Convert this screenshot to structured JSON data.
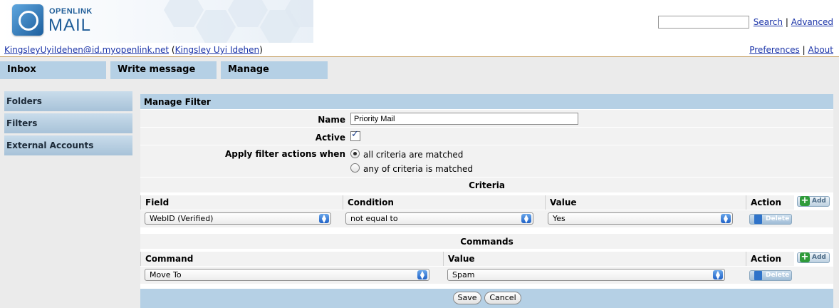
{
  "app": {
    "logo_top": "OPENLINK",
    "logo_bottom": "MAIL"
  },
  "top": {
    "search_value": "",
    "search_link": "Search",
    "separator": "|",
    "advanced_link": "Advanced"
  },
  "user": {
    "email": "KingsleyUyiIdehen@id.myopenlink.net",
    "open_paren": "(",
    "name": "Kingsley Uyi Idehen",
    "close_paren": ")"
  },
  "prefs": {
    "preferences": "Preferences",
    "separator": "|",
    "about": "About"
  },
  "nav": {
    "tabs": [
      "Inbox",
      "Write message",
      "Manage"
    ]
  },
  "sidebar": {
    "items": [
      "Folders",
      "Filters",
      "External Accounts"
    ]
  },
  "filter": {
    "title": "Manage Filter",
    "name_label": "Name",
    "name_value": "Priority Mail",
    "active_label": "Active",
    "active_checked": true,
    "apply_label": "Apply filter actions when",
    "apply_options": [
      "all criteria are matched",
      "any of criteria is matched"
    ],
    "apply_selected": 0
  },
  "criteria": {
    "title": "Criteria",
    "headers": [
      "Field",
      "Condition",
      "Value",
      "Action"
    ],
    "add_label": "Add",
    "rows": [
      {
        "field": "WebID (Verified)",
        "condition": "not equal to",
        "value": "Yes",
        "action": "Delete"
      }
    ]
  },
  "commands": {
    "title": "Commands",
    "headers": [
      "Command",
      "Value",
      "Action"
    ],
    "add_label": "Add",
    "rows": [
      {
        "command": "Move To",
        "value": "Spam",
        "action": "Delete"
      }
    ]
  },
  "buttons": {
    "save": "Save",
    "cancel": "Cancel"
  },
  "icons": {
    "logo": "openlink-mail-logo-icon",
    "select_arrow": "updown-arrow-icon",
    "add": "plus-icon",
    "delete": "document-delete-icon"
  }
}
